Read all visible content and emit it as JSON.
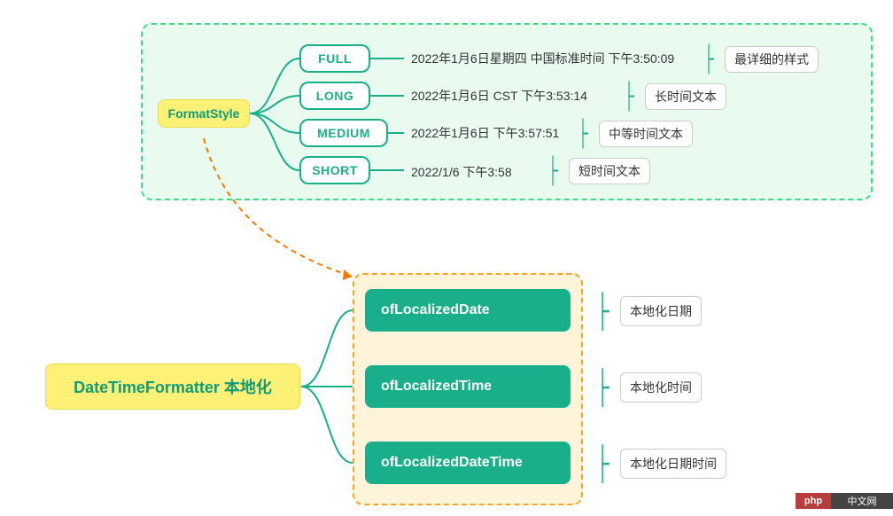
{
  "top": {
    "root": "FormatStyle",
    "items": [
      {
        "label": "FULL",
        "example": "2022年1月6日星期四 中国标准时间 下午3:50:09",
        "note": "最详细的样式"
      },
      {
        "label": "LONG",
        "example": "2022年1月6日 CST 下午3:53:14",
        "note": "长时间文本"
      },
      {
        "label": "MEDIUM",
        "example": "2022年1月6日 下午3:57:51",
        "note": "中等时间文本"
      },
      {
        "label": "SHORT",
        "example": "2022/1/6 下午3:58",
        "note": "短时间文本"
      }
    ]
  },
  "bottom": {
    "root": "DateTimeFormatter 本地化",
    "items": [
      {
        "label": "ofLocalizedDate",
        "note": "本地化日期"
      },
      {
        "label": "ofLocalizedTime",
        "note": "本地化时间"
      },
      {
        "label": "ofLocalizedDateTime",
        "note": "本地化日期时间"
      }
    ]
  },
  "watermark": {
    "left": "php",
    "right": "中文网"
  }
}
